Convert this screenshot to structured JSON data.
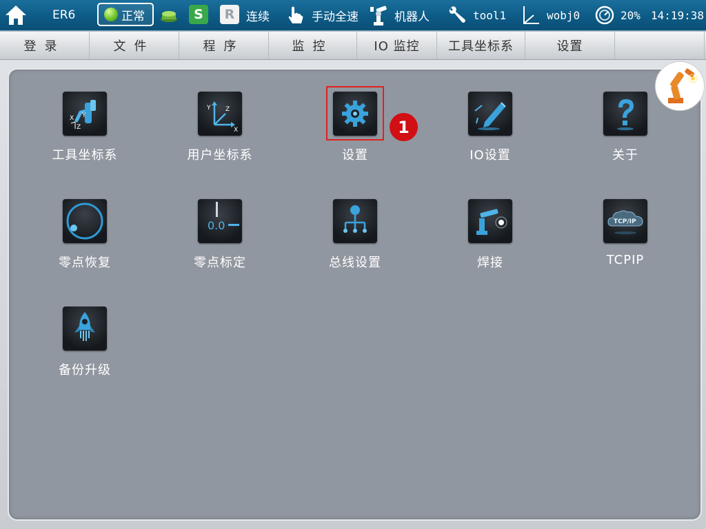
{
  "status_bar": {
    "robot_model": "ER6",
    "state": "正常",
    "servo_badge": "S",
    "program_badge": "R",
    "run_mode": "连续",
    "speed_mode": "手动全速",
    "coordinate_mode": "机器人",
    "tool": "tool1",
    "workobject": "wobj0",
    "speed_percent": "20%",
    "clock": "14:19:38",
    "icons": [
      "home-icon",
      "status-light-icon",
      "servo-icon",
      "hand-icon",
      "robot-arm-icon",
      "wrench-icon",
      "axis-icon",
      "gauge-icon"
    ],
    "state_color": "#6fc32a"
  },
  "menu": {
    "items": [
      "登录",
      "文件",
      "程序",
      "监控",
      "IO 监控",
      "工具坐标系",
      "设置",
      ""
    ]
  },
  "tiles": [
    {
      "label": "工具坐标系",
      "icon": "tool-frame-icon"
    },
    {
      "label": "用户坐标系",
      "icon": "user-frame-icon"
    },
    {
      "label": "设置",
      "icon": "gear-icon"
    },
    {
      "label": "IO设置",
      "icon": "pen-icon"
    },
    {
      "label": "关于",
      "icon": "question-icon"
    },
    {
      "label": "零点恢复",
      "icon": "zero-restore-icon"
    },
    {
      "label": "零点标定",
      "icon": "zero-calibrate-icon",
      "icon_text": "0.0"
    },
    {
      "label": "总线设置",
      "icon": "bus-network-icon"
    },
    {
      "label": "焊接",
      "icon": "welding-icon"
    },
    {
      "label": "TCPIP",
      "icon": "tcpip-cloud-icon",
      "icon_text": "TCP/IP"
    },
    {
      "label": "备份升级",
      "icon": "rocket-icon"
    }
  ],
  "annotation": {
    "step_number": "1",
    "highlight_color": "#e02020",
    "badge_color": "#d10f14"
  },
  "accent_color": "#0d5b86"
}
